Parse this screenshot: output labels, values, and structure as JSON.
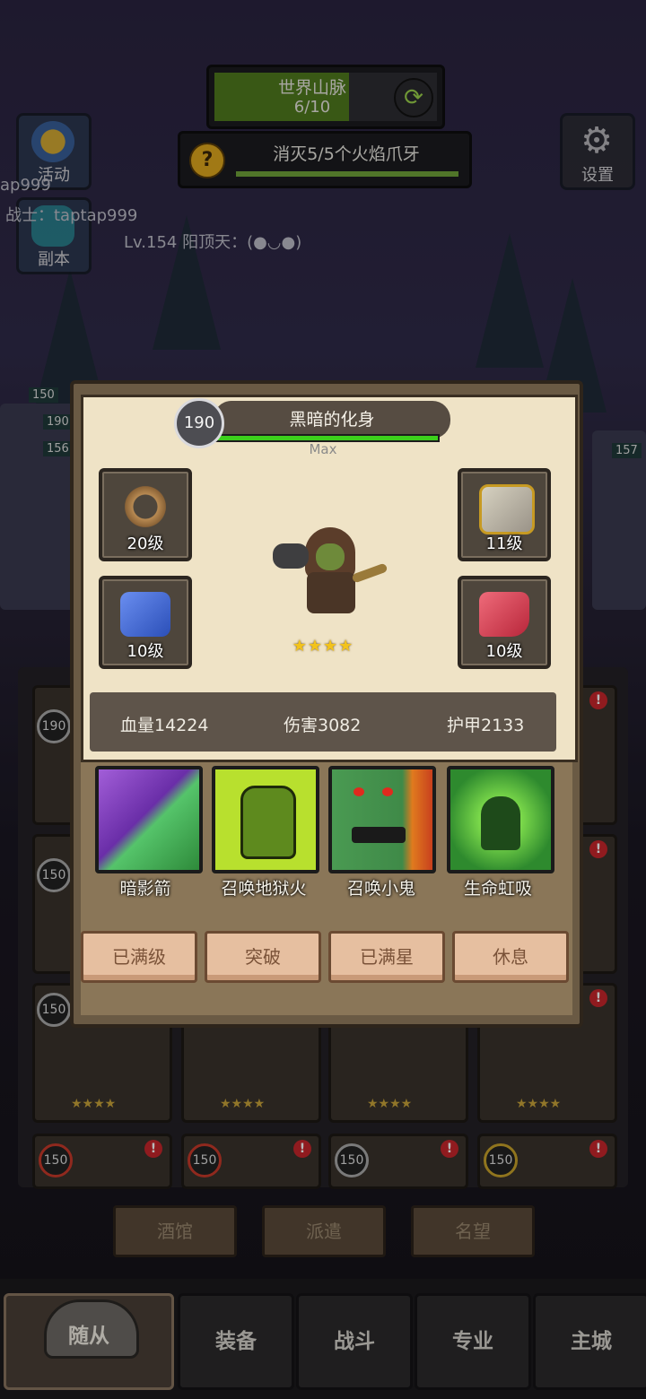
{
  "stage": {
    "name": "世界山脉",
    "progress": "6/10"
  },
  "quest": {
    "text": "消灭5/5个火焰爪牙",
    "help": "?"
  },
  "side": {
    "activity": "活动",
    "dungeon": "副本",
    "settings": "设置"
  },
  "overlay_texts": {
    "p1": "ap999",
    "p2": "战士：taptap999",
    "p3": "Lv.154 阳顶天：(●◡●)"
  },
  "hero": {
    "level": "190",
    "name": "黑暗的化身",
    "hp_label": "Max",
    "stars": "★★★★",
    "equipment": [
      {
        "name": "ring",
        "level": "20级"
      },
      {
        "name": "bracer",
        "level": "11级"
      },
      {
        "name": "cloak",
        "level": "10级"
      },
      {
        "name": "boots",
        "level": "10级"
      }
    ],
    "stats": {
      "hp": "血量14224",
      "damage": "伤害3082",
      "armor": "护甲2133"
    },
    "skills": [
      "暗影箭",
      "召唤地狱火",
      "召唤小鬼",
      "生命虹吸"
    ],
    "actions": [
      "已满级",
      "突破",
      "已满星",
      "休息"
    ]
  },
  "roster": {
    "badges": [
      "190",
      "150",
      "150",
      "150",
      "150",
      "150",
      "150"
    ],
    "side_levels": [
      "150",
      "190",
      "156",
      "157"
    ],
    "card_stars": "★★★★"
  },
  "subtabs": [
    "酒馆",
    "派遣",
    "名望"
  ],
  "nav": [
    "随从",
    "装备",
    "战斗",
    "专业",
    "主城"
  ],
  "colors": {
    "accent_green": "#3cd01c",
    "parchment": "#efe3c6",
    "button": "#e6bfa0"
  }
}
